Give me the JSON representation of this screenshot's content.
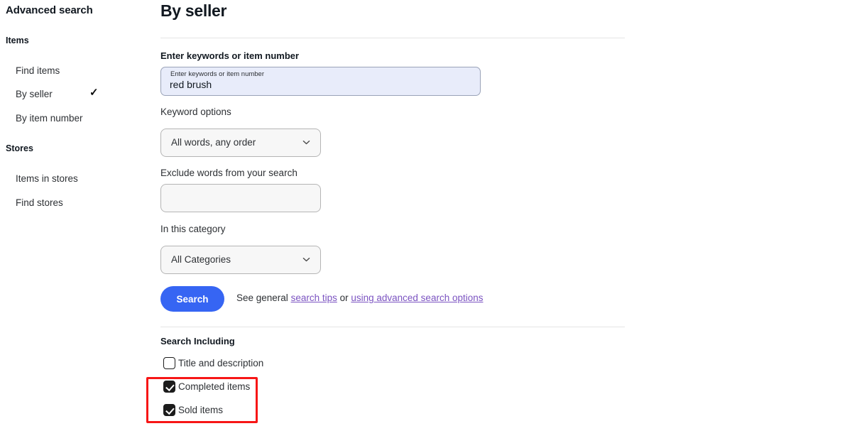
{
  "sidebar": {
    "title": "Advanced search",
    "groups": [
      {
        "heading": "Items",
        "links": [
          "Find items",
          "By seller",
          "By item number"
        ]
      },
      {
        "heading": "Stores",
        "links": [
          "Items in stores",
          "Find stores"
        ]
      }
    ],
    "selected_link": "By seller",
    "selected_marker": "✓"
  },
  "main": {
    "page_title": "By seller",
    "keywords": {
      "label": "Enter keywords or item number",
      "floating_label": "Enter keywords or item number",
      "value": "red brush",
      "placeholder": "Enter keywords or item number"
    },
    "keyword_options": {
      "label": "Keyword options",
      "selected": "All words, any order",
      "options": [
        "All words, any order"
      ]
    },
    "exclude_words": {
      "label": "Exclude words from your search",
      "value": "",
      "placeholder": ""
    },
    "category": {
      "label": "In this category",
      "selected": "All Categories",
      "options": [
        "All Categories"
      ]
    },
    "search_button": "Search",
    "helper": {
      "prefix": "See general ",
      "link1": "search tips",
      "middle": " or ",
      "link2": "using advanced search options"
    },
    "search_including": {
      "label": "Search Including",
      "items": [
        {
          "label": "Title and description",
          "checked": false
        },
        {
          "label": "Completed items",
          "checked": true
        },
        {
          "label": "Sold items",
          "checked": true
        }
      ]
    }
  },
  "colors": {
    "accent_blue": "#3665f3",
    "link_purple": "#7b53c1",
    "annotation_red": "#f71616",
    "field_autofill": "#e8ecfa",
    "checkbox_fill": "#1c1c1c"
  }
}
